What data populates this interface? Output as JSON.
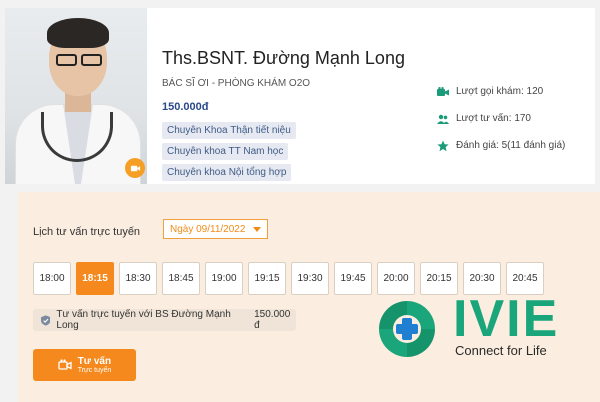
{
  "doctor": {
    "name": "Ths.BSNT. Đường Mạnh Long",
    "role": "BÁC SĨ ƠI - PHÒNG KHÁM O2O",
    "price": "150.000đ",
    "specialties": [
      "Chuyên Khoa Thận tiết niệu",
      "Chuyên khoa TT Nam học",
      "Chuyên khoa Nội tổng hợp"
    ]
  },
  "stats": {
    "video_calls_label": "Lượt gọi khám:",
    "video_calls_value": "120",
    "consults_label": "Lượt tư vấn:",
    "consults_value": "170",
    "rating_label": "Đánh giá:",
    "rating_value": "5(11 đánh giá)"
  },
  "booking": {
    "title": "Lịch tư vấn trực tuyến",
    "date": "Ngày 09/11/2022",
    "slots": [
      "18:00",
      "18:15",
      "18:30",
      "18:45",
      "19:00",
      "19:15",
      "19:30",
      "19:45",
      "20:00",
      "20:15",
      "20:30",
      "20:45"
    ],
    "selected_slot": "18:15",
    "consult_text": "Tư vấn trực tuyến với BS Đường Mạnh Long",
    "consult_fee": "150.000 đ",
    "cta_line1": "Tư vấn",
    "cta_line2": "Trực tuyến"
  },
  "logo": {
    "word": "IVIE",
    "tagline": "Connect for Life"
  },
  "colors": {
    "accent": "#f5891d",
    "brand_green": "#1aa67a",
    "price_blue": "#2b4a8a",
    "booking_bg": "#fbeee0"
  },
  "icons": {
    "video_calls": "video-camera-icon",
    "consults": "users-icon",
    "rating": "star-icon",
    "photo_badge": "video-camera-icon",
    "consult_line": "shield-check-icon"
  }
}
